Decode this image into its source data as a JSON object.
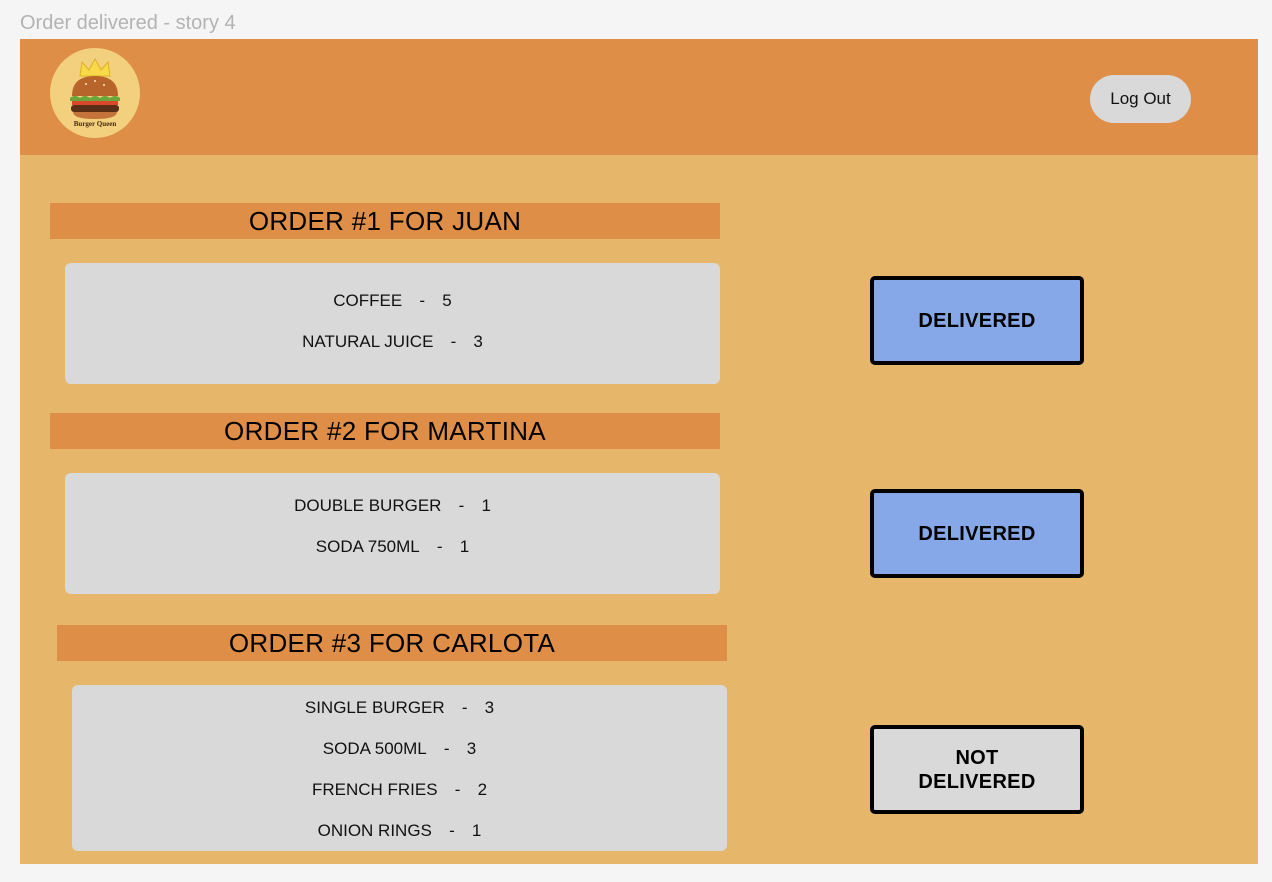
{
  "frame": {
    "title": "Order delivered - story 4"
  },
  "header": {
    "logo_text": "Burger Queen",
    "logout_label": "Log Out"
  },
  "colors": {
    "header": "#df8e47",
    "background": "#e6b76b",
    "delivered": "#86a8e8",
    "not_delivered": "#d9d9d9"
  },
  "orders": [
    {
      "title": "ORDER #1 FOR JUAN",
      "items": [
        {
          "name": "COFFEE",
          "sep": "-",
          "qty": "5"
        },
        {
          "name": "NATURAL JUICE",
          "sep": "-",
          "qty": "3"
        }
      ],
      "status_label": "DELIVERED"
    },
    {
      "title": "ORDER #2 FOR MARTINA",
      "items": [
        {
          "name": "DOUBLE BURGER",
          "sep": "-",
          "qty": "1"
        },
        {
          "name": "SODA 750ML",
          "sep": "-",
          "qty": "1"
        }
      ],
      "status_label": "DELIVERED"
    },
    {
      "title": "ORDER #3 FOR CARLOTA",
      "items": [
        {
          "name": "SINGLE BURGER",
          "sep": "-",
          "qty": "3"
        },
        {
          "name": "SODA 500ML",
          "sep": "-",
          "qty": "3"
        },
        {
          "name": "FRENCH FRIES",
          "sep": "-",
          "qty": "2"
        },
        {
          "name": "ONION RINGS",
          "sep": "-",
          "qty": "1"
        }
      ],
      "status_label_line1": "NOT",
      "status_label_line2": "DELIVERED"
    }
  ]
}
